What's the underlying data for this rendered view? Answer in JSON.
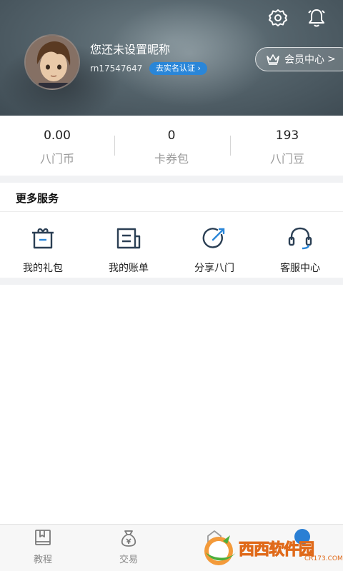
{
  "header": {
    "nickname": "您还未设置昵称",
    "uid": "rn17547647",
    "verify_label": "去实名认证",
    "member_label": "会员中心",
    "member_chevron": ">",
    "settings_icon": "gear-icon",
    "bell_icon": "bell-icon"
  },
  "stats": [
    {
      "value": "0.00",
      "label": "八门币"
    },
    {
      "value": "0",
      "label": "卡券包"
    },
    {
      "value": "193",
      "label": "八门豆"
    }
  ],
  "services": {
    "title": "更多服务",
    "items": [
      {
        "label": "我的礼包",
        "icon": "gift-icon"
      },
      {
        "label": "我的账单",
        "icon": "bill-icon"
      },
      {
        "label": "分享八门",
        "icon": "share-icon"
      },
      {
        "label": "客服中心",
        "icon": "headset-icon"
      }
    ]
  },
  "bottom_nav": {
    "items": [
      {
        "label": "教程",
        "icon": "book-icon"
      },
      {
        "label": "交易",
        "icon": "money-bag-icon"
      }
    ]
  },
  "watermark": {
    "text_a": "西西",
    "text_b": "软件园",
    "sub": "CR173.COM"
  },
  "colors": {
    "accent": "#2a86d8",
    "icon": "#2b3f54",
    "watermark": "#e06a1a"
  }
}
